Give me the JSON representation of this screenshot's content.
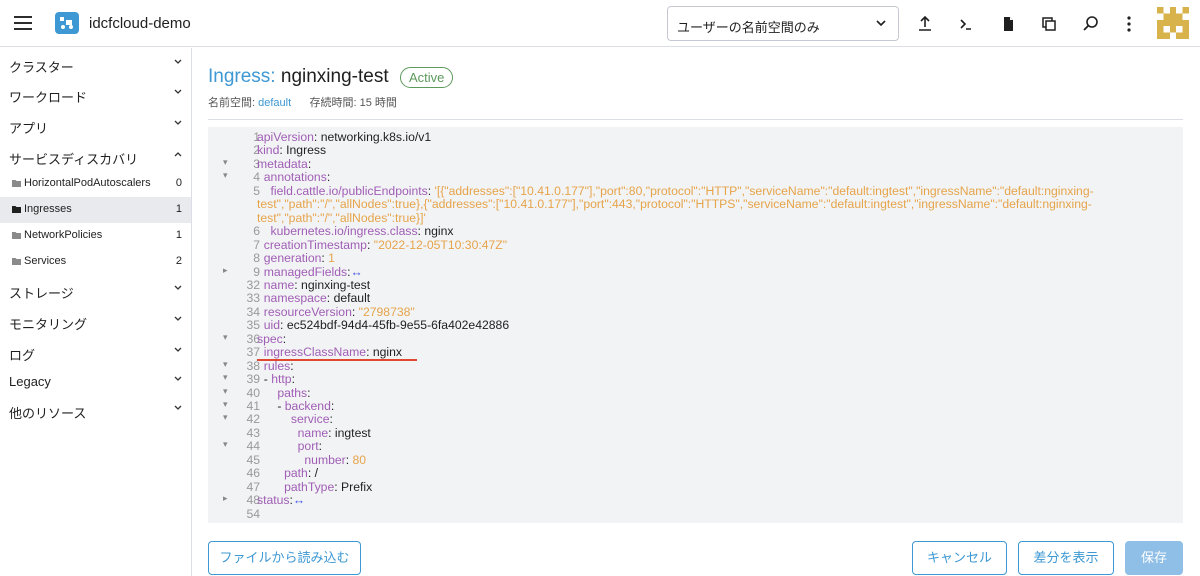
{
  "header": {
    "cluster_name": "idcfcloud-demo",
    "namespace_select": "ユーザーの名前空間のみ",
    "icons": [
      "menu-icon",
      "cluster-icon",
      "upload-icon",
      "shell-icon",
      "file-icon",
      "copy-icon",
      "search-icon",
      "more-icon",
      "avatar"
    ]
  },
  "sidebar": {
    "groups": [
      {
        "label": "クラスター",
        "state": "collapsed"
      },
      {
        "label": "ワークロード",
        "state": "collapsed"
      },
      {
        "label": "アプリ",
        "state": "collapsed"
      },
      {
        "label": "サービスディスカバリ",
        "state": "expanded"
      },
      {
        "label": "ストレージ",
        "state": "collapsed"
      },
      {
        "label": "モニタリング",
        "state": "collapsed"
      },
      {
        "label": "ログ",
        "state": "collapsed"
      },
      {
        "label": "Legacy",
        "state": "collapsed"
      },
      {
        "label": "他のリソース",
        "state": "collapsed"
      }
    ],
    "children": [
      {
        "label": "HorizontalPodAutoscalers",
        "count": "0"
      },
      {
        "label": "Ingresses",
        "count": "1",
        "active": true
      },
      {
        "label": "NetworkPolicies",
        "count": "1"
      },
      {
        "label": "Services",
        "count": "2"
      }
    ]
  },
  "page": {
    "kind": "Ingress:",
    "name": "nginxing-test",
    "status": "Active",
    "namespace_label": "名前空間:",
    "namespace_value": "default",
    "age_label": "存続時間:",
    "age_value": "15 時間"
  },
  "yaml": {
    "lines": [
      {
        "n": "1",
        "fold": "",
        "html": "<span class='k'>apiVersion</span>: networking.k8s.io/v1"
      },
      {
        "n": "2",
        "fold": "",
        "html": "<span class='k'>kind</span>: Ingress"
      },
      {
        "n": "3",
        "fold": "▾",
        "html": "<span class='k'>metadata</span>:"
      },
      {
        "n": "4",
        "fold": "▾",
        "html": "  <span class='k'>annotations</span>:"
      },
      {
        "n": "5",
        "fold": "",
        "html": "    <span class='k'>field.cattle.io/publicEndpoints</span>: <span class='s'>'[{\"addresses\":[\"10.41.0.177\"],\"port\":80,\"protocol\":\"HTTP\",\"serviceName\":\"default:ingtest\",\"ingressName\":\"default:nginxing-</span>"
      },
      {
        "n": "",
        "fold": "",
        "html": "<span class='s'>test\",\"path\":\"/\",\"allNodes\":true},{\"addresses\":[\"10.41.0.177\"],\"port\":443,\"protocol\":\"HTTPS\",\"serviceName\":\"default:ingtest\",\"ingressName\":\"default:nginxing-</span>"
      },
      {
        "n": "",
        "fold": "",
        "html": "<span class='s'>test\",\"path\":\"/\",\"allNodes\":true}]'</span>"
      },
      {
        "n": "6",
        "fold": "",
        "html": "    <span class='k'>kubernetes.io/ingress.class</span>: nginx"
      },
      {
        "n": "7",
        "fold": "",
        "html": "  <span class='k'>creationTimestamp</span>: <span class='s'>\"2022-12-05T10:30:47Z\"</span>"
      },
      {
        "n": "8",
        "fold": "",
        "html": "  <span class='k'>generation</span>: <span class='s'>1</span>"
      },
      {
        "n": "9",
        "fold": "▸",
        "html": "  <span class='k'>managedFields</span>:<span class='fd'>↔</span>"
      },
      {
        "n": "32",
        "fold": "",
        "html": "  <span class='k'>name</span>: nginxing-test"
      },
      {
        "n": "33",
        "fold": "",
        "html": "  <span class='k'>namespace</span>: default"
      },
      {
        "n": "34",
        "fold": "",
        "html": "  <span class='k'>resourceVersion</span>: <span class='s'>\"2798738\"</span>"
      },
      {
        "n": "35",
        "fold": "",
        "html": "  <span class='k'>uid</span>: ec524bdf-94d4-45fb-9e55-6fa402e42886"
      },
      {
        "n": "36",
        "fold": "▾",
        "html": "<span class='k'>spec</span>:"
      },
      {
        "n": "37",
        "fold": "",
        "html": "  <span class='k'>ingressClassName</span>: nginx"
      },
      {
        "n": "38",
        "fold": "▾",
        "html": "  <span class='k'>rules</span>:"
      },
      {
        "n": "39",
        "fold": "▾",
        "html": "  - <span class='k'>http</span>:"
      },
      {
        "n": "40",
        "fold": "▾",
        "html": "      <span class='k'>paths</span>:"
      },
      {
        "n": "41",
        "fold": "▾",
        "html": "      - <span class='k'>backend</span>:"
      },
      {
        "n": "42",
        "fold": "▾",
        "html": "          <span class='k'>service</span>:"
      },
      {
        "n": "43",
        "fold": "",
        "html": "            <span class='k'>name</span>: ingtest"
      },
      {
        "n": "44",
        "fold": "▾",
        "html": "            <span class='k'>port</span>:"
      },
      {
        "n": "45",
        "fold": "",
        "html": "              <span class='k'>number</span>: <span class='s'>80</span>"
      },
      {
        "n": "46",
        "fold": "",
        "html": "        <span class='k'>path</span>: /"
      },
      {
        "n": "47",
        "fold": "",
        "html": "        <span class='k'>pathType</span>: Prefix"
      },
      {
        "n": "48",
        "fold": "▸",
        "html": "<span class='k'>status</span>:<span class='fd'>↔</span>"
      },
      {
        "n": "54",
        "fold": "",
        "html": ""
      }
    ]
  },
  "footer": {
    "load_file": "ファイルから読み込む",
    "cancel": "キャンセル",
    "show_diff": "差分を表示",
    "save": "保存"
  },
  "colors": {
    "accent": "#3d98d3",
    "active_badge": "#5d995d",
    "yaml_key": "#a05eb5",
    "yaml_string": "#e6a44a",
    "highlight_underline": "#e0492f"
  }
}
